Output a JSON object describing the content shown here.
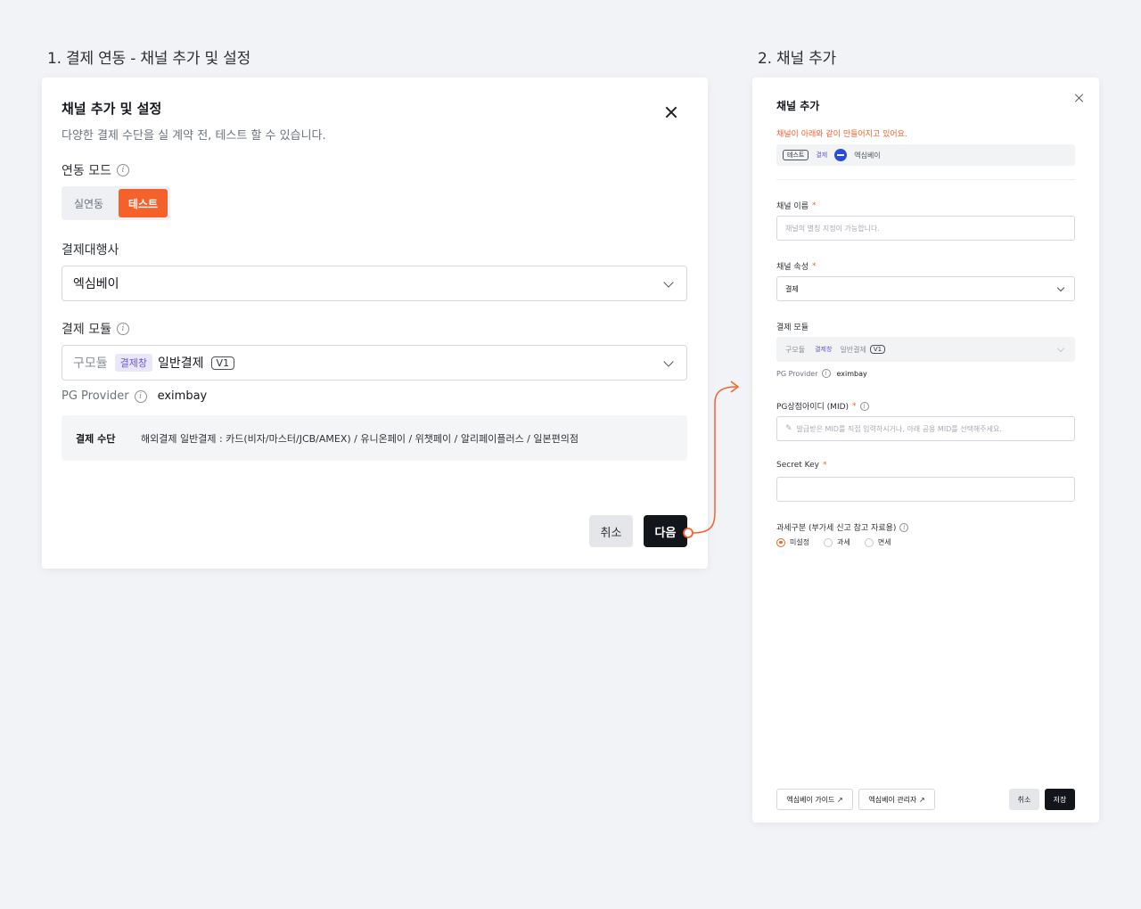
{
  "step1": {
    "heading": "1. 결제 연동 - 채널 추가 및 설정",
    "dialog_title": "채널 추가 및 설정",
    "dialog_subtitle": "다양한 결제 수단을 실 계약 전, 테스트 할 수 있습니다.",
    "mode_label": "연동 모드",
    "mode_options": [
      "실연동",
      "테스트"
    ],
    "mode_selected": "테스트",
    "pg_label": "결제대행사",
    "pg_value": "엑심베이",
    "module_label": "결제 모듈",
    "module_old": "구모듈",
    "module_tag": "결제창",
    "module_name": "일반결제",
    "module_version": "V1",
    "provider_label": "PG Provider",
    "provider_value": "eximbay",
    "method_key": "결제 수단",
    "method_value": "해외결제 일반결제 : 카드(비자/마스터/JCB/AMEX) / 유니온페이 / 위챗페이 / 알리페이플러스 / 일본편의점",
    "cancel_label": "취소",
    "next_label": "다음"
  },
  "step2": {
    "heading": "2. 채널 추가",
    "dialog_title": "채널 추가",
    "notice": "채널이 아래와 같이 만들어지고 있어요.",
    "preview_tag": "테스트",
    "preview_type": "결제",
    "preview_name": "엑심베이",
    "name_label": "채널 이름",
    "name_placeholder": "채널의 별칭 지정이 가능합니다.",
    "attr_label": "채널 속성",
    "attr_value": "결제",
    "module_label": "결제 모듈",
    "module_old": "구모듈",
    "module_tag": "결제창",
    "module_name": "일반결제",
    "module_version": "V1",
    "provider_label": "PG Provider",
    "provider_value": "eximbay",
    "mid_label": "PG상점아이디 (MID)",
    "mid_placeholder": "발급받은 MID를 직접 입력하시거나, 아래 공용 MID를 선택해주세요.",
    "secret_label": "Secret Key",
    "secret_value": "",
    "tax_label": "과세구분 (부가세 신고 참고 자료용)",
    "tax_options": [
      "미설정",
      "과세",
      "면세"
    ],
    "tax_selected": "미설정",
    "guide_link": "엑심베이 가이드 ↗",
    "admin_link": "엑심베이 관리자 ↗",
    "cancel_label": "취소",
    "save_label": "저장",
    "required_mark": "*"
  },
  "colors": {
    "accent": "#f5612b",
    "dark": "#12151a",
    "purple": "#6b56d6",
    "brand_blue": "#2a4be0"
  }
}
